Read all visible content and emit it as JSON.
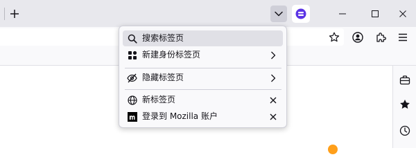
{
  "menu": {
    "search_label": "搜索标签页",
    "new_container_label": "新建身份标签页",
    "hidden_tabs_label": "隐藏标签页",
    "open_tabs": [
      {
        "label": "新标签页",
        "icon": "globe-icon"
      },
      {
        "label": "登录到 Mozilla 账户",
        "icon": "mozilla-icon"
      }
    ]
  },
  "colors": {
    "tabstrip_bg": "#e8e8ed",
    "toolbar_bg": "#f9f9fb",
    "accent_purple": "#5b34e5",
    "highlight_bg": "#e0e0e6"
  }
}
